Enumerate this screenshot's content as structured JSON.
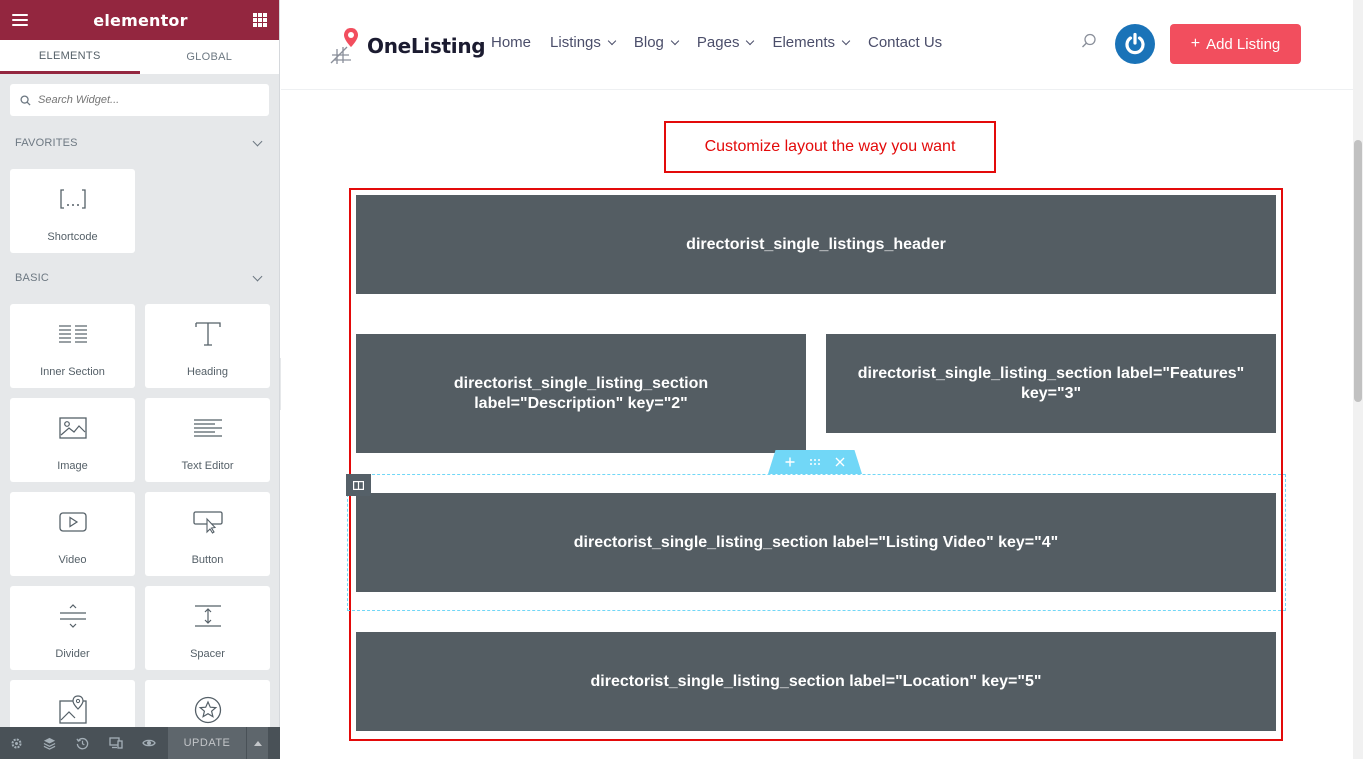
{
  "sidebar": {
    "brand": "elementor",
    "tabs": [
      {
        "label": "ELEMENTS",
        "active": true
      },
      {
        "label": "GLOBAL",
        "active": false
      }
    ],
    "search_placeholder": "Search Widget...",
    "categories": {
      "favorites": {
        "title": "FAVORITES",
        "widgets": [
          {
            "label": "Shortcode",
            "icon": "shortcode-icon"
          }
        ]
      },
      "basic": {
        "title": "BASIC",
        "widgets": [
          {
            "label": "Inner Section",
            "icon": "inner-section-icon"
          },
          {
            "label": "Heading",
            "icon": "heading-icon"
          },
          {
            "label": "Image",
            "icon": "image-icon"
          },
          {
            "label": "Text Editor",
            "icon": "text-editor-icon"
          },
          {
            "label": "Video",
            "icon": "video-icon"
          },
          {
            "label": "Button",
            "icon": "button-icon"
          },
          {
            "label": "Divider",
            "icon": "divider-icon"
          },
          {
            "label": "Spacer",
            "icon": "spacer-icon"
          },
          {
            "label": "",
            "icon": "google-maps-icon"
          },
          {
            "label": "",
            "icon": "star-icon"
          }
        ]
      }
    },
    "footer": {
      "icons": [
        "settings-icon",
        "navigator-icon",
        "history-icon",
        "responsive-icon",
        "preview-icon"
      ],
      "update_label": "UPDATE"
    }
  },
  "site": {
    "logo_text": "OneListing",
    "nav": [
      {
        "label": "Home",
        "dropdown": false
      },
      {
        "label": "Listings",
        "dropdown": true
      },
      {
        "label": "Blog",
        "dropdown": true
      },
      {
        "label": "Pages",
        "dropdown": true
      },
      {
        "label": "Elements",
        "dropdown": true
      },
      {
        "label": "Contact Us",
        "dropdown": false
      }
    ],
    "add_listing_label": "Add Listing",
    "accent_color": "#f24e5e"
  },
  "canvas": {
    "callout": "Customize layout the way you want",
    "blocks": {
      "header": "directorist_single_listings_header",
      "description": "directorist_single_listing_section label=\"Description\" key=\"2\"",
      "features": "directorist_single_listing_section label=\"Features\" key=\"3\"",
      "video": "directorist_single_listing_section label=\"Listing Video\" key=\"4\"",
      "location": "directorist_single_listing_section label=\"Location\" key=\"5\""
    }
  }
}
